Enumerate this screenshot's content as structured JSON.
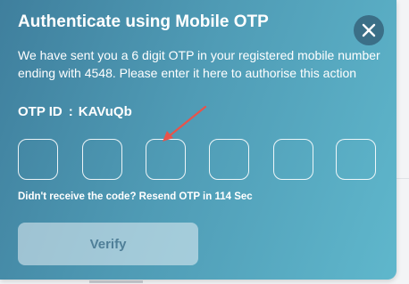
{
  "dialog": {
    "title": "Authenticate using Mobile OTP",
    "message": "We have sent you a 6 digit OTP in your registered mobile number ending with 4548. Please enter it here to authorise this action",
    "otp_id_label": "OTP ID",
    "otp_id_separator": ":",
    "otp_id_value": "KAVuQb",
    "otp_inputs": [
      "",
      "",
      "",
      "",
      "",
      ""
    ],
    "resend_prefix": "Didn't receive the code?",
    "resend_link": "Resend OTP",
    "resend_timer": "in 114 Sec",
    "verify_label": "Verify",
    "close_icon": "close-icon"
  },
  "colors": {
    "gradient_start": "#3f7f9d",
    "gradient_end": "#5fb7cc",
    "close_button_bg": "#3b6f87",
    "annotation_arrow": "#e8534a",
    "verify_text": "#4f7f98"
  }
}
